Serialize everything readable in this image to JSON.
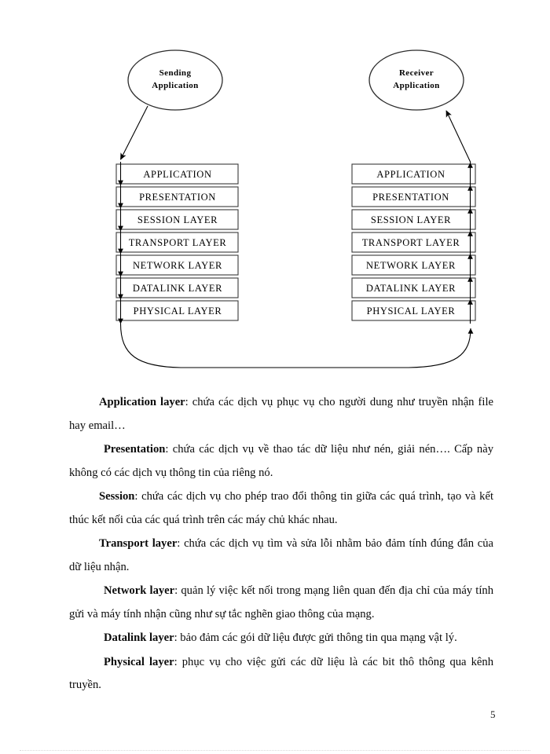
{
  "diagram": {
    "sending_node": {
      "line1": "Sending",
      "line2": "Application"
    },
    "receiver_node": {
      "line1": "Receiver",
      "line2": "Application"
    },
    "layers": [
      "APPLICATION",
      "PRESENTATION",
      "SESSION LAYER",
      "TRANSPORT LAYER",
      "NETWORK LAYER",
      "DATALINK LAYER",
      "PHYSICAL LAYER"
    ],
    "colors": {
      "stroke": "#2b2b2b",
      "box_stroke": "#3a3a3a",
      "fill": "#ffffff"
    }
  },
  "content": {
    "paragraphs": [
      {
        "term": "Application layer",
        "text": ": chứa các dịch vụ phục vụ cho người dung như truyền nhận file hay email…"
      },
      {
        "term": "Presentation",
        "text": ": chứa các dịch vụ về thao tác dữ liệu như nén, giải nén…. Cấp này không có các dịch vụ thông tin của riêng nó."
      },
      {
        "term": "Session",
        "text": ": chứa các dịch vụ cho phép trao đổi thông tin giữa các quá trình, tạo và kết thúc kết nối của các quá trình trên các máy chủ khác nhau."
      },
      {
        "term": "Transport layer",
        "text": ": chứa các dịch vụ tìm và sửa lỗi nhằm bảo đảm tính đúng đắn của dữ liệu nhận."
      },
      {
        "term": "Network layer",
        "text": ": quản lý việc kết nối trong mạng liên quan đến địa chỉ của máy tính gửi và máy tính nhận cũng như sự tắc nghẽn giao thông của mạng."
      },
      {
        "term": "Datalink layer",
        "text": ": bảo đảm các gói dữ liệu được gửi thông tin qua mạng vật lý."
      },
      {
        "term": "Physical layer",
        "text": ": phục vụ cho việc gửi các dữ liệu là các bit thô thông qua kênh truyền."
      }
    ]
  },
  "footer": {
    "page_number": "5"
  }
}
